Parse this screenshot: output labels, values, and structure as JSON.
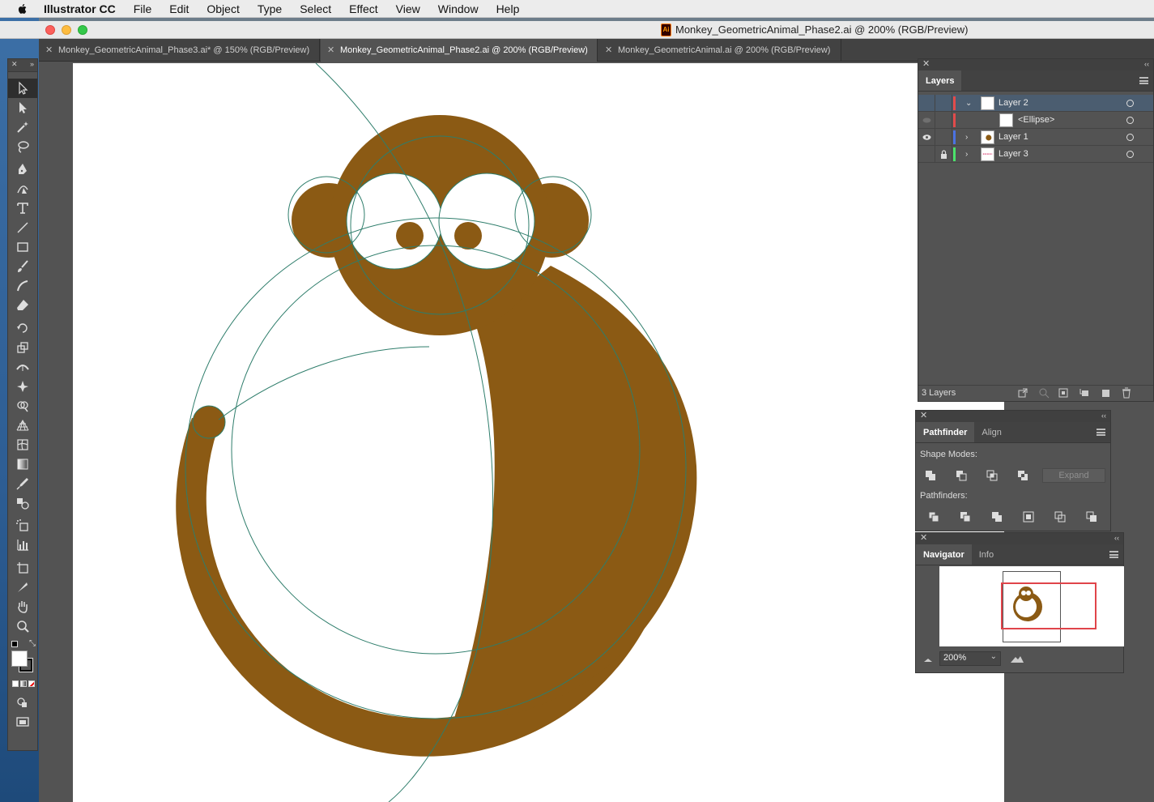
{
  "menubar": {
    "app_name": "Illustrator CC",
    "items": [
      "File",
      "Edit",
      "Object",
      "Type",
      "Select",
      "Effect",
      "View",
      "Window",
      "Help"
    ]
  },
  "window": {
    "title": "Monkey_GeometricAnimal_Phase2.ai @ 200% (RGB/Preview)"
  },
  "doc_tabs": [
    {
      "label": "Monkey_GeometricAnimal_Phase3.ai* @ 150% (RGB/Preview)",
      "active": false
    },
    {
      "label": "Monkey_GeometricAnimal_Phase2.ai @ 200% (RGB/Preview)",
      "active": true
    },
    {
      "label": "Monkey_GeometricAnimal.ai @ 200% (RGB/Preview)",
      "active": false
    }
  ],
  "tools": [
    "selection-tool",
    "direct-selection-tool",
    "magic-wand-tool",
    "lasso-tool",
    "pen-tool",
    "curvature-tool",
    "type-tool",
    "line-tool",
    "rectangle-tool",
    "paintbrush-tool",
    "shaper-tool",
    "eraser-tool",
    "rotate-tool",
    "scale-tool",
    "width-tool",
    "puppet-warp-tool",
    "shape-builder-tool",
    "perspective-grid-tool",
    "mesh-tool",
    "gradient-tool",
    "eyedropper-tool",
    "blend-tool",
    "symbol-sprayer-tool",
    "column-graph-tool",
    "artboard-tool",
    "slice-tool",
    "hand-tool",
    "zoom-tool"
  ],
  "layers_panel": {
    "tab": "Layers",
    "rows": [
      {
        "name": "Layer 2",
        "color": "#e24b4b",
        "selected": true,
        "expanded": true
      },
      {
        "name": "<Ellipse>",
        "color": "#e24b4b",
        "selected": false,
        "child": true
      },
      {
        "name": "Layer 1",
        "color": "#4b72e2",
        "selected": false,
        "expanded": false
      },
      {
        "name": "Layer 3",
        "color": "#4be26a",
        "selected": false,
        "expanded": false,
        "locked": true
      }
    ],
    "footer_count": "3 Layers"
  },
  "pathfinder_panel": {
    "tabs": [
      "Pathfinder",
      "Align"
    ],
    "shape_modes_label": "Shape Modes:",
    "pathfinders_label": "Pathfinders:",
    "expand_label": "Expand"
  },
  "navigator_panel": {
    "tabs": [
      "Navigator",
      "Info"
    ],
    "zoom_value": "200%"
  },
  "colors": {
    "monkey_brown": "#8b5a14",
    "guide_green": "#2e7d6b",
    "ui_panel": "#535353"
  }
}
